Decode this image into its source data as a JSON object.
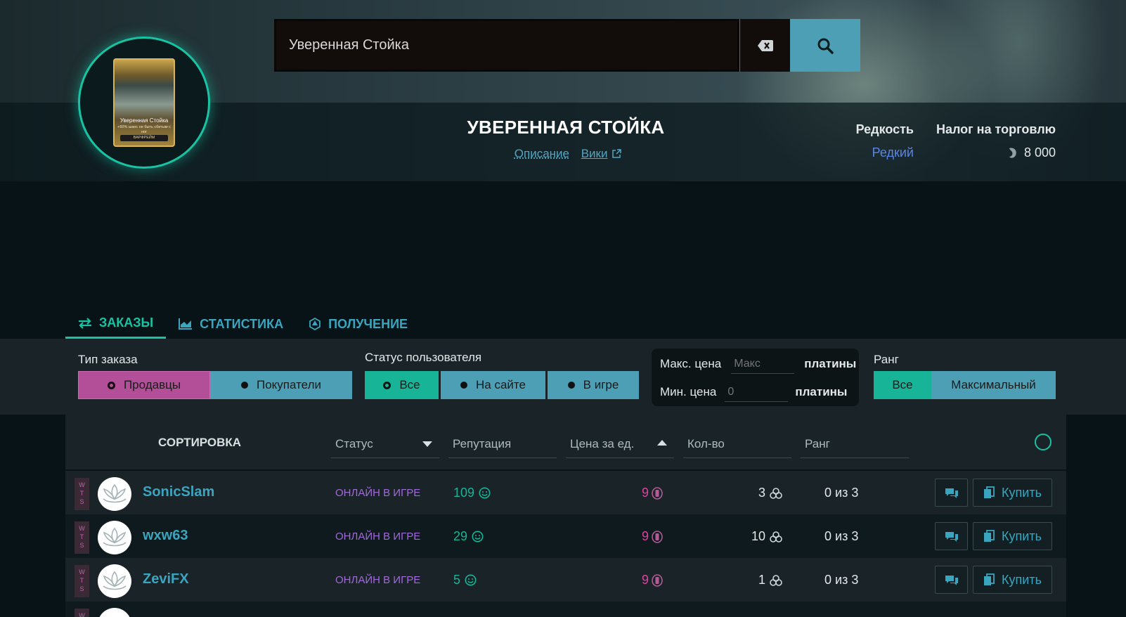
{
  "search": {
    "value": "Уверенная Стойка"
  },
  "mod_card": {
    "title": "Уверенная Стойка",
    "description": "+60% шанс не быть сбитым с ног",
    "tag": "ВАРФРЕЙМ"
  },
  "item": {
    "title": "УВЕРЕННАЯ СТОЙКА",
    "description_link": "Описание",
    "wiki_link": "Вики"
  },
  "info": {
    "rarity_label": "Редкость",
    "rarity_value": "Редкий",
    "tax_label": "Налог на торговлю",
    "tax_value": "8 000"
  },
  "tabs": [
    {
      "label": "Заказы",
      "icon": "exchange-icon",
      "active": true
    },
    {
      "label": "Статистика",
      "icon": "chart-icon",
      "active": false
    },
    {
      "label": "Получение",
      "icon": "dice-icon",
      "active": false
    }
  ],
  "filters": {
    "order_type_label": "Тип заказа",
    "sellers": "Продавцы",
    "buyers": "Покупатели",
    "user_status_label": "Статус пользователя",
    "status_all": "Все",
    "status_site": "На сайте",
    "status_game": "В игре",
    "max_price_label": "Макс. цена",
    "max_price_placeholder": "Макс",
    "min_price_label": "Мин. цена",
    "min_price_placeholder": "0",
    "platinum": "платины",
    "rank_label": "Ранг",
    "rank_all": "Все",
    "rank_max": "Максимальный"
  },
  "table": {
    "sort_title": "СОРТИРОВКА",
    "headers": {
      "status": "Статус",
      "reputation": "Репутация",
      "price": "Цена за ед.",
      "qty": "Кол-во",
      "rank": "Ранг"
    },
    "rows": [
      {
        "badge": "WTS",
        "name": "SonicSlam",
        "status": "ОНЛАЙН В ИГРЕ",
        "rep": "109",
        "price": "9",
        "qty": "3",
        "rank": "0 из 3",
        "buy": "Купить"
      },
      {
        "badge": "WTS",
        "name": "wxw63",
        "status": "ОНЛАЙН В ИГРЕ",
        "rep": "29",
        "price": "9",
        "qty": "10",
        "rank": "0 из 3",
        "buy": "Купить"
      },
      {
        "badge": "WTS",
        "name": "ZeviFX",
        "status": "ОНЛАЙН В ИГРЕ",
        "rep": "5",
        "price": "9",
        "qty": "1",
        "rank": "0 из 3",
        "buy": "Купить"
      }
    ]
  },
  "colors": {
    "accent_green": "#18c3a3",
    "accent_blue": "#4d9fb5",
    "accent_pink": "#b24f98",
    "online_purple": "#a06ad8",
    "price_pink": "#e040a0"
  }
}
